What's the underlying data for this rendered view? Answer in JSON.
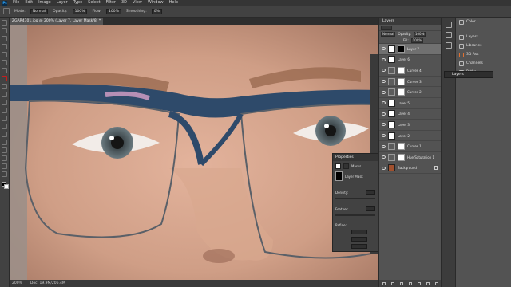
{
  "menu": [
    "File",
    "Edit",
    "Image",
    "Layer",
    "Type",
    "Select",
    "Filter",
    "3D",
    "View",
    "Window",
    "Help"
  ],
  "options": {
    "mode_label": "Mode:",
    "mode_value": "Normal",
    "opacity_label": "Opacity:",
    "opacity_value": "100%",
    "flow_label": "Flow:",
    "flow_value": "100%",
    "smoothing_label": "Smoothing:",
    "smoothing_value": "0%"
  },
  "document_tab": "ZGAR4301.jpg @ 200% (Layer 7, Layer Mask/8) *",
  "status": {
    "zoom": "200%",
    "doc": "Doc: 19.9M/206.4M"
  },
  "layers_panel": {
    "tab": "Layers",
    "blend_mode": "Normal",
    "opacity_label": "Opacity:",
    "opacity_value": "100%",
    "fill_label": "Fill:",
    "fill_value": "100%",
    "rows": [
      {
        "name": "Layer 7",
        "type": "mask"
      },
      {
        "name": "Layer 6",
        "type": "pixel"
      },
      {
        "name": "Curves 4",
        "type": "adj"
      },
      {
        "name": "Curves 3",
        "type": "adj"
      },
      {
        "name": "Curves 2",
        "type": "adj"
      },
      {
        "name": "Layer 5",
        "type": "pixel"
      },
      {
        "name": "Layer 4",
        "type": "pixel"
      },
      {
        "name": "Layer 3",
        "type": "pixel"
      },
      {
        "name": "Layer 2",
        "type": "pixel"
      },
      {
        "name": "Curves 1",
        "type": "adj"
      },
      {
        "name": "Hue/Saturation 1",
        "type": "adj"
      },
      {
        "name": "Background",
        "type": "bg"
      }
    ]
  },
  "right_panel": {
    "color_tab": "Color",
    "items": [
      "Layers",
      "Libraries",
      "3D Ass",
      "Channels",
      "Paths"
    ],
    "layers_flyout": "Layers"
  },
  "properties_panel": {
    "title": "Properties",
    "masks_label": "Masks",
    "layer_mask_label": "Layer Mask",
    "density_label": "Density:",
    "feather_label": "Feather:",
    "refine_label": "Refine:"
  }
}
